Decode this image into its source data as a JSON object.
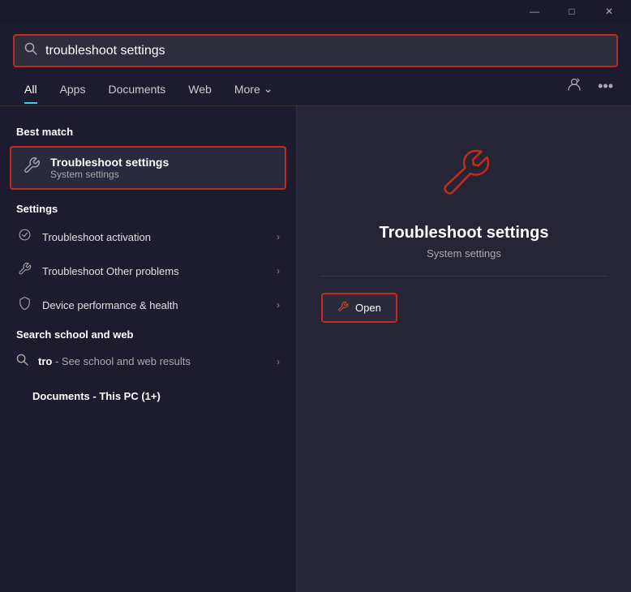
{
  "titlebar": {
    "minimize": "—",
    "maximize": "□",
    "close": "✕"
  },
  "search": {
    "value": "troubleshoot settings",
    "placeholder": "troubleshoot settings"
  },
  "tabs": [
    {
      "id": "all",
      "label": "All",
      "active": true
    },
    {
      "id": "apps",
      "label": "Apps",
      "active": false
    },
    {
      "id": "documents",
      "label": "Documents",
      "active": false
    },
    {
      "id": "web",
      "label": "Web",
      "active": false
    },
    {
      "id": "more",
      "label": "More",
      "active": false
    }
  ],
  "tabs_right_icons": {
    "profile": "👤",
    "more": "•••"
  },
  "best_match": {
    "section_label": "Best match",
    "item": {
      "title": "Troubleshoot settings",
      "subtitle": "System settings",
      "icon": "🔧"
    }
  },
  "settings_section": {
    "label": "Settings",
    "items": [
      {
        "icon": "⊘",
        "label": "Troubleshoot activation"
      },
      {
        "icon": "🔧",
        "label": "Troubleshoot Other problems"
      },
      {
        "icon": "🛡",
        "label": "Device performance & health"
      }
    ]
  },
  "search_web": {
    "label": "Search school and web",
    "item": {
      "query": "tro",
      "suffix": "- See school and web results"
    }
  },
  "documents_section": {
    "label": "Documents - This PC (1+)"
  },
  "right_panel": {
    "title": "Troubleshoot settings",
    "subtitle": "System settings",
    "open_label": "Open"
  }
}
